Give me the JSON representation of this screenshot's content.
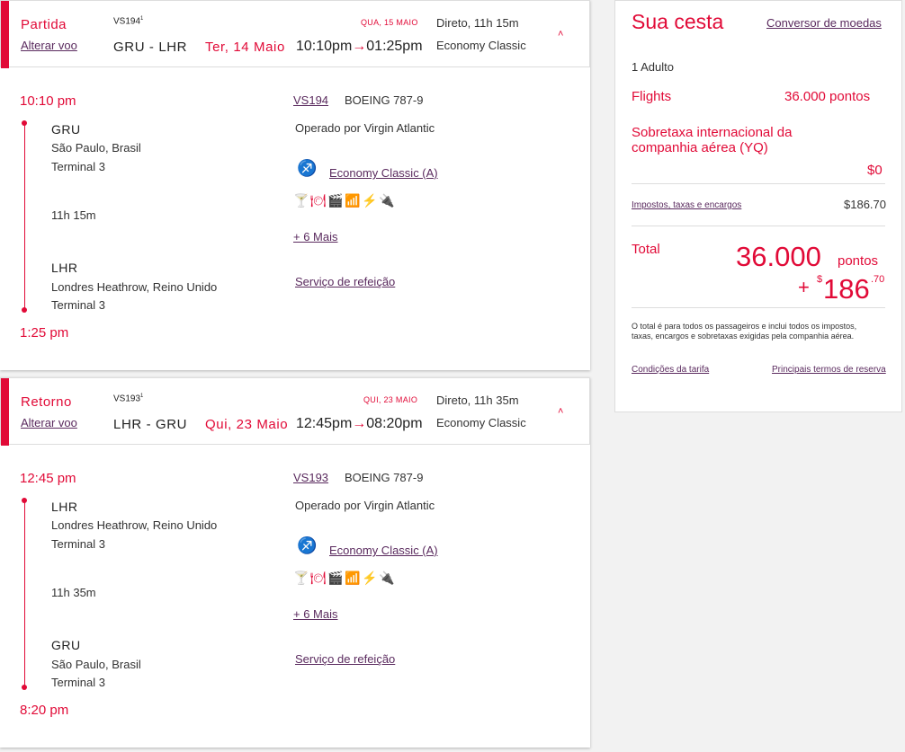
{
  "outbound": {
    "label": "Partida",
    "change": "Alterar voo",
    "flight_no": "VS194",
    "flight_sup": "1",
    "date_arr": "QUA, 15 MAIO",
    "direct": "Direto, 11h 15m",
    "from": "GRU",
    "dash": "-",
    "to": "LHR",
    "date": "Ter, 14 Maio",
    "dep": "10:10pm",
    "arr": "01:25pm",
    "arrow": "→",
    "cabin": "Economy Classic",
    "chevron": "˄",
    "detail": {
      "dep_time": "10:10 pm",
      "dep_code": "GRU",
      "dep_city": "São Paulo, Brasil",
      "dep_terminal": "Terminal 3",
      "duration": "11h 15m",
      "arr_code": "LHR",
      "arr_city": "Londres Heathrow, Reino Unido",
      "arr_terminal": "Terminal 3",
      "arr_time": "1:25 pm",
      "flight_link": "VS194",
      "aircraft": "BOEING 787-9",
      "operated": "Operado por Virgin Atlantic",
      "fare": "Economy Classic (A)",
      "more": "+ 6 Mais",
      "meal": "Serviço de refeição"
    }
  },
  "return": {
    "label": "Retorno",
    "change": "Alterar voo",
    "flight_no": "VS193",
    "flight_sup": "1",
    "date_arr": "QUI, 23 MAIO",
    "direct": "Direto, 11h 35m",
    "from": "LHR",
    "dash": "-",
    "to": "GRU",
    "date": "Qui, 23 Maio",
    "dep": "12:45pm",
    "arr": "08:20pm",
    "arrow": "→",
    "cabin": "Economy Classic",
    "chevron": "˄",
    "detail": {
      "dep_time": "12:45 pm",
      "dep_code": "LHR",
      "dep_city": "Londres Heathrow, Reino Unido",
      "dep_terminal": "Terminal 3",
      "duration": "11h 35m",
      "arr_code": "GRU",
      "arr_city": "São Paulo, Brasil",
      "arr_terminal": "Terminal 3",
      "arr_time": "8:20 pm",
      "flight_link": "VS193",
      "aircraft": "BOEING 787-9",
      "operated": "Operado por Virgin Atlantic",
      "fare": "Economy Classic (A)",
      "more": "+ 6 Mais",
      "meal": "Serviço de refeição"
    }
  },
  "amenity_icons": [
    "seat-icon",
    "drink-icon",
    "meal-icon",
    "entertainment-icon",
    "wifi-icon",
    "usb-icon",
    "power-icon"
  ],
  "basket": {
    "title": "Sua cesta",
    "converter": "Conversor de moedas",
    "passengers": "1 Adulto",
    "flights_label": "Flights",
    "flights_value": "36.000 pontos",
    "surcharge_label": "Sobretaxa internacional da companhia aérea (YQ)",
    "surcharge_value": "$0",
    "taxes_label": "Impostos, taxas e encargos",
    "taxes_value": "$186.70",
    "total_label": "Total",
    "total_points": "36.000",
    "points_unit": "pontos",
    "plus": "+",
    "currency": "$",
    "total_cash": "186",
    "total_cents": ".70",
    "disclaimer": "O total é para todos os passageiros e inclui todos os impostos, taxas, encargos e sobretaxas exigidas pela companhia aérea.",
    "conditions": "Condições da tarifa",
    "terms": "Principais termos de reserva"
  },
  "colors": {
    "accent": "#e10a37",
    "link": "#5a2a5e"
  }
}
